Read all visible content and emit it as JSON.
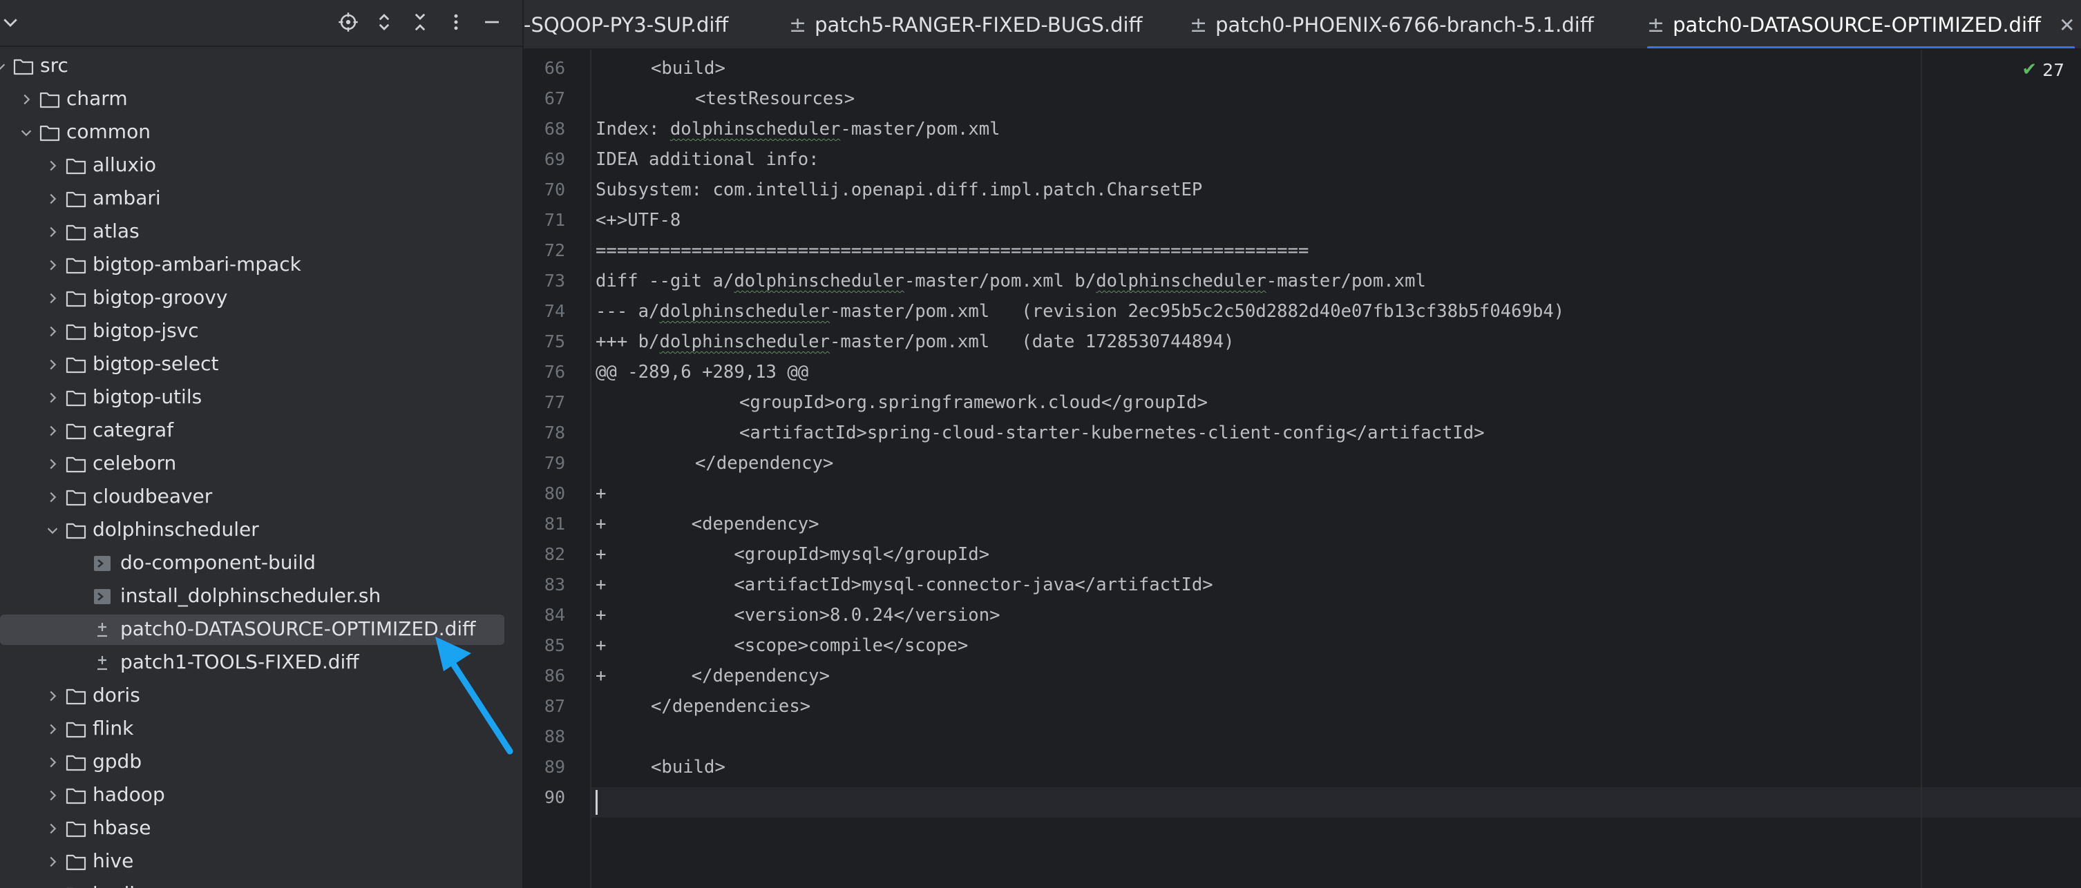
{
  "tree": {
    "rows": [
      {
        "label": "src",
        "state": "expanded",
        "kind": "folder",
        "depth": 0
      },
      {
        "label": "charm",
        "state": "collapsed",
        "kind": "folder",
        "depth": 1
      },
      {
        "label": "common",
        "state": "expanded",
        "kind": "folder",
        "depth": 1
      },
      {
        "label": "alluxio",
        "state": "collapsed",
        "kind": "folder",
        "depth": 2
      },
      {
        "label": "ambari",
        "state": "collapsed",
        "kind": "folder",
        "depth": 2
      },
      {
        "label": "atlas",
        "state": "collapsed",
        "kind": "folder",
        "depth": 2
      },
      {
        "label": "bigtop-ambari-mpack",
        "state": "collapsed",
        "kind": "folder",
        "depth": 2
      },
      {
        "label": "bigtop-groovy",
        "state": "collapsed",
        "kind": "folder",
        "depth": 2
      },
      {
        "label": "bigtop-jsvc",
        "state": "collapsed",
        "kind": "folder",
        "depth": 2
      },
      {
        "label": "bigtop-select",
        "state": "collapsed",
        "kind": "folder",
        "depth": 2
      },
      {
        "label": "bigtop-utils",
        "state": "collapsed",
        "kind": "folder",
        "depth": 2
      },
      {
        "label": "categraf",
        "state": "collapsed",
        "kind": "folder",
        "depth": 2
      },
      {
        "label": "celeborn",
        "state": "collapsed",
        "kind": "folder",
        "depth": 2
      },
      {
        "label": "cloudbeaver",
        "state": "collapsed",
        "kind": "folder",
        "depth": 2
      },
      {
        "label": "dolphinscheduler",
        "state": "expanded",
        "kind": "folder",
        "depth": 2
      },
      {
        "label": "do-component-build",
        "state": "none",
        "kind": "script",
        "depth": 3
      },
      {
        "label": "install_dolphinscheduler.sh",
        "state": "none",
        "kind": "script",
        "depth": 3
      },
      {
        "label": "patch0-DATASOURCE-OPTIMIZED.diff",
        "state": "none",
        "kind": "diff",
        "depth": 3,
        "selected": true
      },
      {
        "label": "patch1-TOOLS-FIXED.diff",
        "state": "none",
        "kind": "diff",
        "depth": 3
      },
      {
        "label": "doris",
        "state": "collapsed",
        "kind": "folder",
        "depth": 2
      },
      {
        "label": "flink",
        "state": "collapsed",
        "kind": "folder",
        "depth": 2
      },
      {
        "label": "gpdb",
        "state": "collapsed",
        "kind": "folder",
        "depth": 2
      },
      {
        "label": "hadoop",
        "state": "collapsed",
        "kind": "folder",
        "depth": 2
      },
      {
        "label": "hbase",
        "state": "collapsed",
        "kind": "folder",
        "depth": 2
      },
      {
        "label": "hive",
        "state": "collapsed",
        "kind": "folder",
        "depth": 2
      },
      {
        "label": "hudi",
        "state": "collapsed",
        "kind": "folder",
        "depth": 2
      }
    ]
  },
  "tabs": [
    {
      "label": "-SQOOP-PY3-SUP.diff",
      "active": false,
      "glyph": ""
    },
    {
      "label": "patch5-RANGER-FIXED-BUGS.diff",
      "active": false,
      "glyph": "±"
    },
    {
      "label": "patch0-PHOENIX-6766-branch-5.1.diff",
      "active": false,
      "glyph": "±"
    },
    {
      "label": "patch0-DATASOURCE-OPTIMIZED.diff",
      "active": true,
      "glyph": "±"
    }
  ],
  "editor": {
    "inspection_count": "27",
    "lines": [
      {
        "n": "66",
        "indent": 5,
        "text": "<build>",
        "ul": ""
      },
      {
        "n": "67",
        "indent": 9,
        "text": "<testResources>",
        "ul": ""
      },
      {
        "n": "68",
        "indent": 0,
        "text": "Index: dolphinscheduler-master/pom.xml",
        "ul": "dolphinscheduler"
      },
      {
        "n": "69",
        "indent": 0,
        "text": "IDEA additional info:",
        "ul": ""
      },
      {
        "n": "70",
        "indent": 0,
        "text": "Subsystem: com.intellij.openapi.diff.impl.patch.CharsetEP",
        "ul": ""
      },
      {
        "n": "71",
        "indent": 0,
        "text": "<+>UTF-8",
        "ul": ""
      },
      {
        "n": "72",
        "indent": 0,
        "text": "===================================================================",
        "ul": ""
      },
      {
        "n": "73",
        "indent": 0,
        "text": "diff --git a/dolphinscheduler-master/pom.xml b/dolphinscheduler-master/pom.xml",
        "ul": "dolphinscheduler"
      },
      {
        "n": "74",
        "indent": 0,
        "text": "--- a/dolphinscheduler-master/pom.xml   (revision 2ec95b5c2c50d2882d40e07fb13cf38b5f0469b4)",
        "ul": "dolphinscheduler"
      },
      {
        "n": "75",
        "indent": 0,
        "text": "+++ b/dolphinscheduler-master/pom.xml   (date 1728530744894)",
        "ul": "dolphinscheduler"
      },
      {
        "n": "76",
        "indent": 0,
        "text": "@@ -289,6 +289,13 @@",
        "ul": ""
      },
      {
        "n": "77",
        "indent": 13,
        "text": "<groupId>org.springframework.cloud</groupId>",
        "ul": ""
      },
      {
        "n": "78",
        "indent": 13,
        "text": "<artifactId>spring-cloud-starter-kubernetes-client-config</artifactId>",
        "ul": ""
      },
      {
        "n": "79",
        "indent": 9,
        "text": "</dependency>",
        "ul": ""
      },
      {
        "n": "80",
        "indent": 0,
        "text": "+",
        "ul": ""
      },
      {
        "n": "81",
        "indent": 0,
        "text": "+        <dependency>",
        "ul": ""
      },
      {
        "n": "82",
        "indent": 0,
        "text": "+            <groupId>mysql</groupId>",
        "ul": ""
      },
      {
        "n": "83",
        "indent": 0,
        "text": "+            <artifactId>mysql-connector-java</artifactId>",
        "ul": ""
      },
      {
        "n": "84",
        "indent": 0,
        "text": "+            <version>8.0.24</version>",
        "ul": ""
      },
      {
        "n": "85",
        "indent": 0,
        "text": "+            <scope>compile</scope>",
        "ul": ""
      },
      {
        "n": "86",
        "indent": 0,
        "text": "+        </dependency>",
        "ul": ""
      },
      {
        "n": "87",
        "indent": 5,
        "text": "</dependencies>",
        "ul": ""
      },
      {
        "n": "88",
        "indent": 0,
        "text": "",
        "ul": ""
      },
      {
        "n": "89",
        "indent": 5,
        "text": "<build>",
        "ul": ""
      },
      {
        "n": "90",
        "indent": 0,
        "text": "",
        "ul": "",
        "current": true
      }
    ]
  },
  "colors": {
    "accent": "#3574f0",
    "selection": "#43454a",
    "annotation_arrow": "#1aa3f0",
    "inspection_ok": "#5fb865"
  }
}
